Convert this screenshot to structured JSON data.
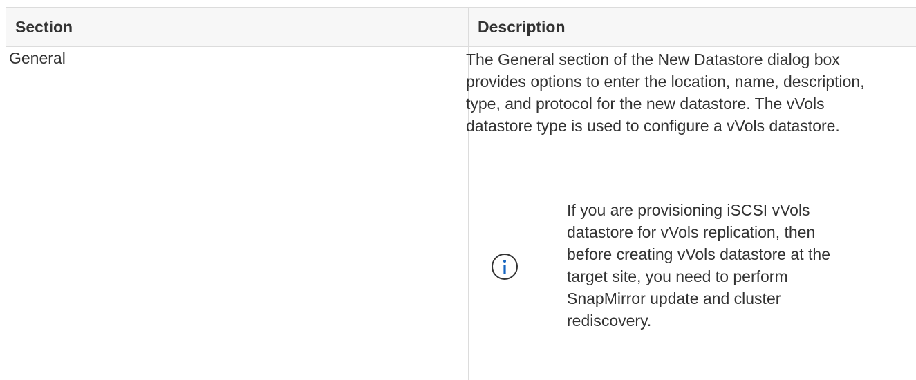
{
  "table": {
    "headers": {
      "section": "Section",
      "description": "Description"
    },
    "rows": [
      {
        "section": "General",
        "description": "The General section of the New Datastore dialog box provides options to enter the location, name, description, type, and protocol for the new datastore. The vVols datastore type is used to configure a vVols datastore.",
        "note": {
          "icon": "info-icon",
          "text": "If you are provisioning iSCSI vVols datastore for vVols replication, then before creating vVols datastore at the target site, you need to perform SnapMirror update and cluster rediscovery."
        }
      }
    ]
  },
  "colors": {
    "info_icon": "#1565c0",
    "border": "#dcdcdc",
    "text": "#333333"
  }
}
